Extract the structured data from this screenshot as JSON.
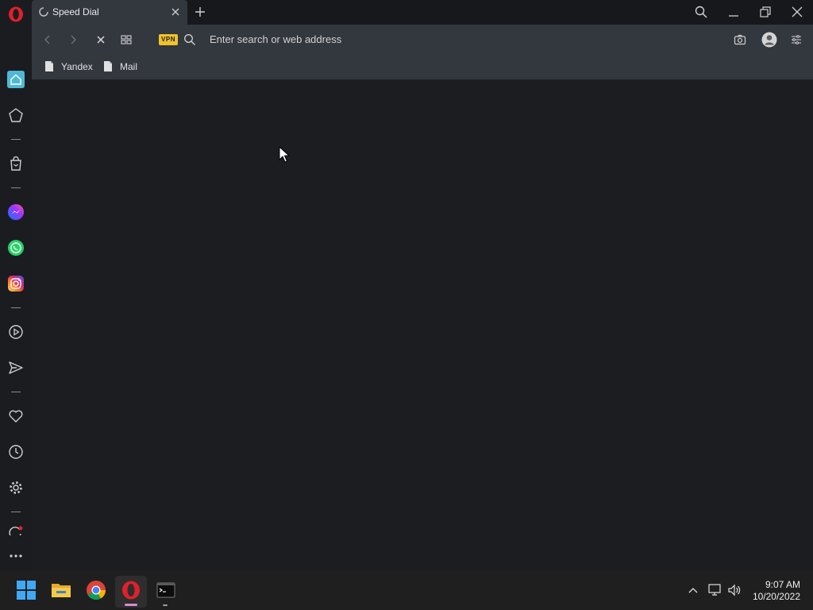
{
  "tab": {
    "title": "Speed Dial"
  },
  "toolbar": {
    "address_placeholder": "Enter search or web address",
    "vpn_label": "VPN"
  },
  "bookmarks": [
    {
      "label": "Yandex"
    },
    {
      "label": "Mail"
    }
  ],
  "taskbar": {
    "time": "9:07 AM",
    "date": "10/20/2022"
  },
  "colors": {
    "accent": "#4fb8d8",
    "vpn_badge": "#f0c22c",
    "opera_red": "#e0202b",
    "toolbar_bg": "#33373e"
  }
}
